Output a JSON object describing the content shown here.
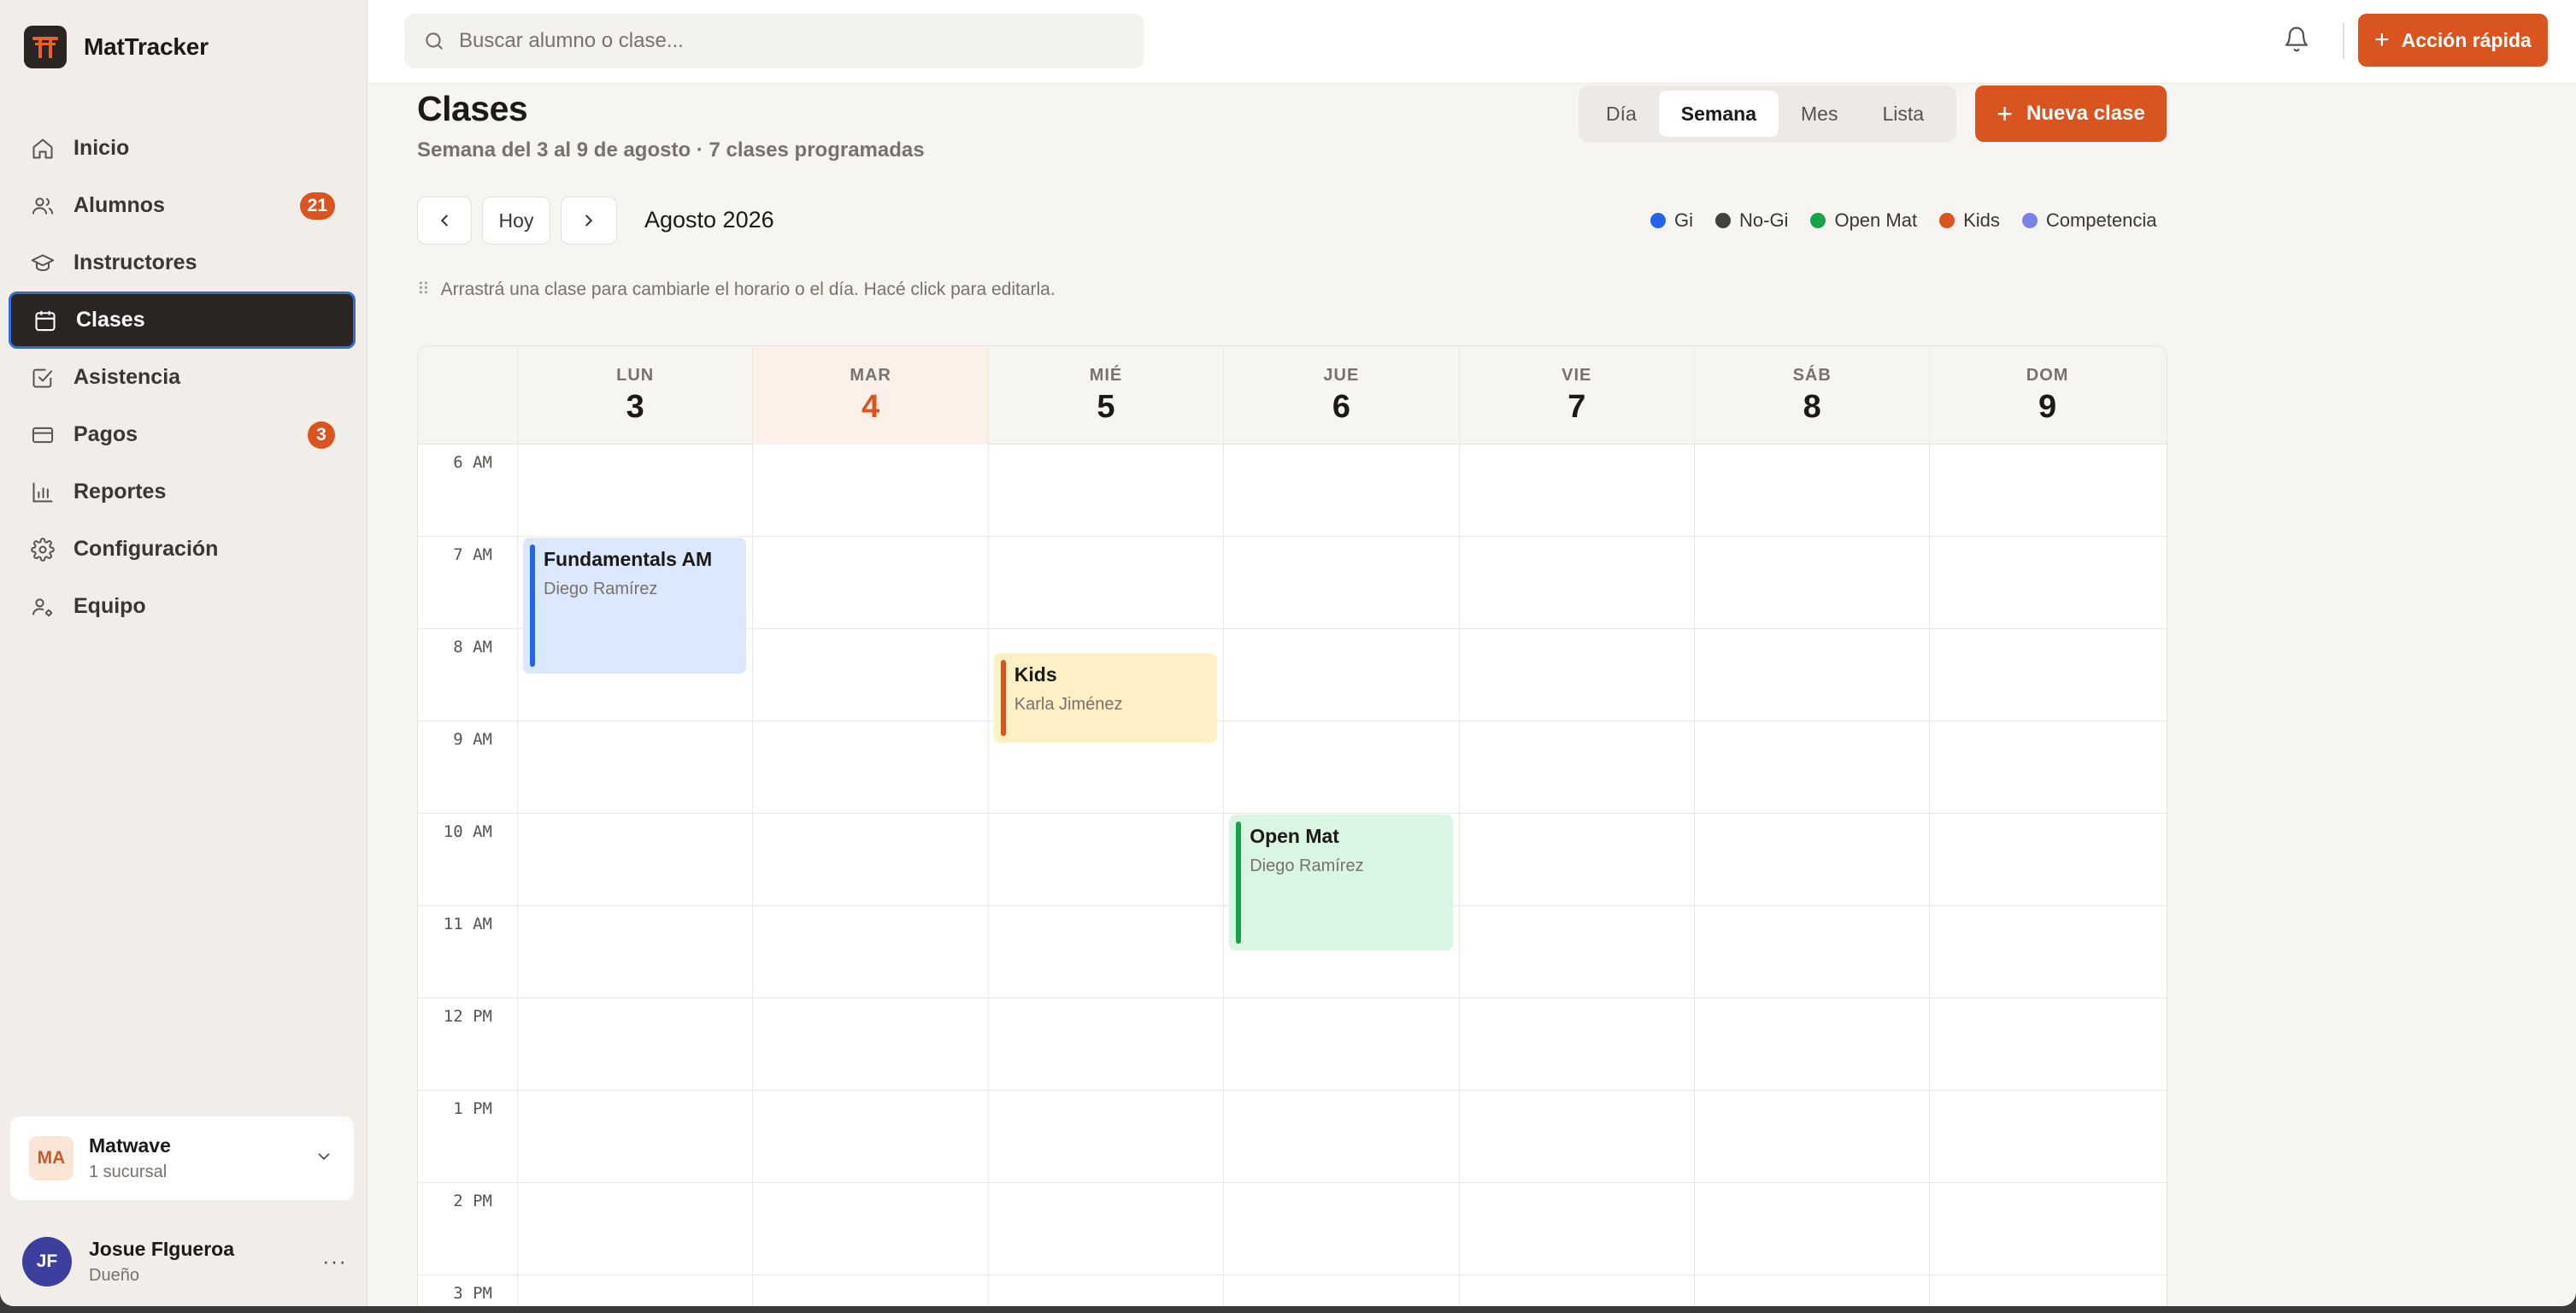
{
  "app": {
    "name": "MatTracker"
  },
  "sidebar": {
    "items": [
      {
        "label": "Inicio",
        "icon": "home-icon"
      },
      {
        "label": "Alumnos",
        "icon": "users-icon",
        "badge": "21"
      },
      {
        "label": "Instructores",
        "icon": "graduation-cap-icon"
      },
      {
        "label": "Clases",
        "icon": "calendar-icon",
        "active": true
      },
      {
        "label": "Asistencia",
        "icon": "checkbox-icon"
      },
      {
        "label": "Pagos",
        "icon": "credit-card-icon",
        "badge": "3"
      },
      {
        "label": "Reportes",
        "icon": "bar-chart-icon"
      },
      {
        "label": "Configuración",
        "icon": "gear-icon"
      },
      {
        "label": "Equipo",
        "icon": "user-gear-icon"
      }
    ],
    "org": {
      "initials": "MA",
      "name": "Matwave",
      "sub": "1 sucursal"
    },
    "user": {
      "initials": "JF",
      "name": "Josue FIgueroa",
      "role": "Dueño"
    }
  },
  "topbar": {
    "search_placeholder": "Buscar alumno o clase...",
    "quick_action_label": "Acción rápida"
  },
  "page": {
    "title": "Clases",
    "subtitle": "Semana del 3 al 9 de agosto · 7 clases programadas",
    "views": [
      "Día",
      "Semana",
      "Mes",
      "Lista"
    ],
    "active_view": "Semana",
    "new_class_label": "Nueva clase",
    "today_label": "Hoy",
    "month_label": "Agosto 2026",
    "hint": "Arrastrá una clase para cambiarle el horario o el día. Hacé click para editarla."
  },
  "legend": [
    {
      "label": "Gi",
      "color": "#2563eb"
    },
    {
      "label": "No-Gi",
      "color": "#44403c"
    },
    {
      "label": "Open Mat",
      "color": "#16a34a"
    },
    {
      "label": "Kids",
      "color": "#d9541e"
    },
    {
      "label": "Competencia",
      "color": "#7c83e6"
    }
  ],
  "calendar": {
    "days": [
      {
        "abbr": "LUN",
        "num": "3"
      },
      {
        "abbr": "MAR",
        "num": "4",
        "today": true
      },
      {
        "abbr": "MIÉ",
        "num": "5"
      },
      {
        "abbr": "JUE",
        "num": "6"
      },
      {
        "abbr": "VIE",
        "num": "7"
      },
      {
        "abbr": "SÁB",
        "num": "8"
      },
      {
        "abbr": "DOM",
        "num": "9"
      }
    ],
    "hours": [
      "6 AM",
      "7 AM",
      "8 AM",
      "9 AM",
      "10 AM",
      "11 AM",
      "12 PM",
      "1 PM",
      "2 PM",
      "3 PM"
    ],
    "events": [
      {
        "title": "Fundamentals AM",
        "instructor": "Diego Ramírez",
        "day": 0,
        "start": 7.0,
        "end": 8.5,
        "type": "Gi",
        "bg": "#dbe8fd",
        "bar": "#2563eb"
      },
      {
        "title": "Kids",
        "instructor": "Karla Jiménez",
        "day": 2,
        "start": 8.25,
        "end": 9.25,
        "type": "Kids",
        "bg": "#fdf0c4",
        "bar": "#d9541e"
      },
      {
        "title": "Open Mat",
        "instructor": "Diego Ramírez",
        "day": 3,
        "start": 10.0,
        "end": 11.5,
        "type": "Open Mat",
        "bg": "#d9f6e3",
        "bar": "#16a34a"
      }
    ]
  }
}
